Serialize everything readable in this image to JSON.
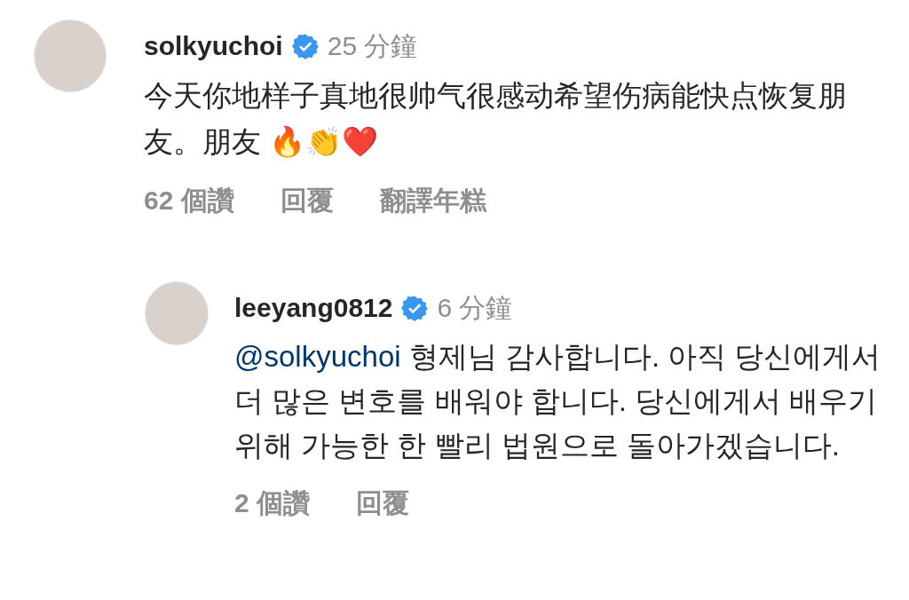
{
  "comments": [
    {
      "username": "solkyuchoi",
      "verified": true,
      "time": "25 分鐘",
      "text": "今天你地样子真地很帅气很感动希望伤病能快点恢复朋友。朋友 🔥👏❤️",
      "likes": "62 個讚",
      "reply": "回覆",
      "translate": "翻譯年糕",
      "replies": [
        {
          "username": "leeyang0812",
          "verified": true,
          "time": "6 分鐘",
          "mention": "@solkyuchoi",
          "text": " 형제님 감사합니다. 아직 당신에게서 더 많은 변호를 배워야 합니다. 당신에게서 배우기 위해 가능한 한 빨리 법원으로 돌아가겠습니다.",
          "likes": "2 個讚",
          "reply": "回覆"
        }
      ]
    }
  ]
}
